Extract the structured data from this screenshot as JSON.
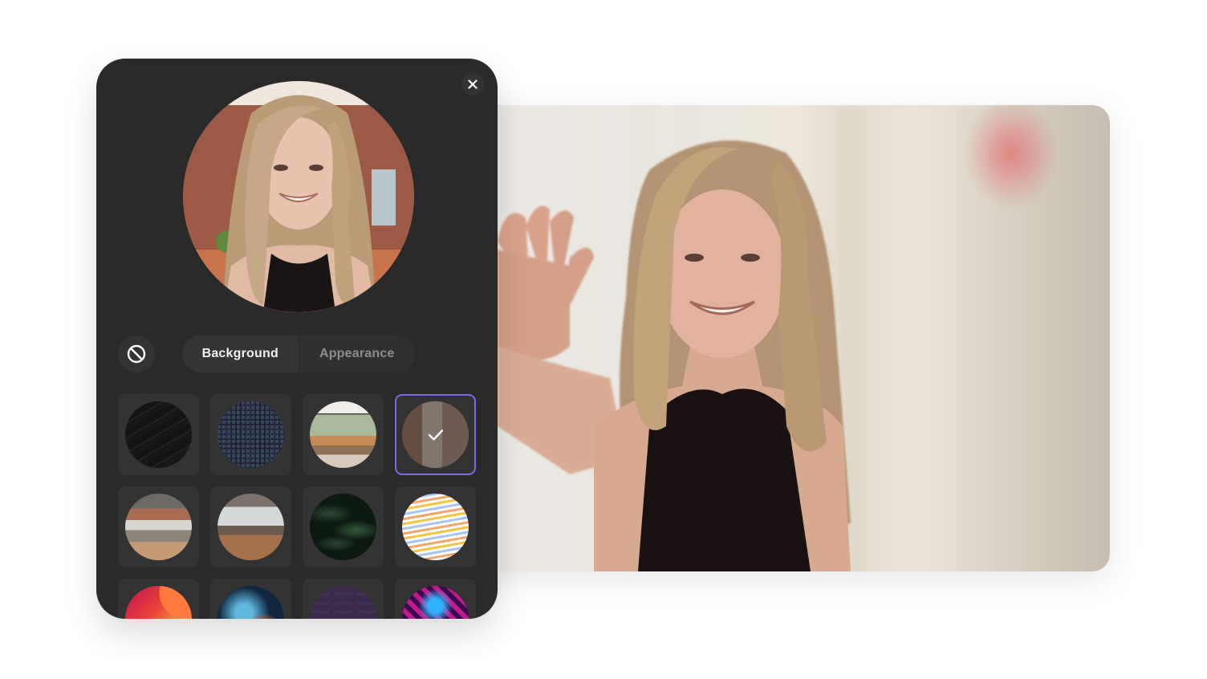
{
  "panel": {
    "close_icon": "close-icon",
    "preview_alt": "Camera preview with virtual background",
    "no_effect_icon": "prohibited-icon",
    "tabs": [
      {
        "label": "Background",
        "active": true
      },
      {
        "label": "Appearance",
        "active": false
      }
    ],
    "backgrounds": [
      {
        "name": "black-sand",
        "selected": false
      },
      {
        "name": "dark-texture",
        "selected": false
      },
      {
        "name": "living-room",
        "selected": false
      },
      {
        "name": "brick-loft",
        "selected": true
      },
      {
        "name": "office-1",
        "selected": false
      },
      {
        "name": "office-2",
        "selected": false
      },
      {
        "name": "leaves",
        "selected": false
      },
      {
        "name": "waves",
        "selected": false
      },
      {
        "name": "gradient-flow",
        "selected": false
      },
      {
        "name": "galaxy",
        "selected": false
      },
      {
        "name": "purple-brand",
        "selected": false,
        "watermark": "sendspark"
      },
      {
        "name": "neon-cubes",
        "selected": false
      }
    ],
    "selected_icon": "checkmark-icon"
  },
  "video": {
    "description": "Live camera feed with blurred background"
  },
  "colors": {
    "panel_bg": "#2a2a2a",
    "selected_border": "#7b68ee",
    "active_tab_text": "#f2f2f2",
    "inactive_tab_text": "#8d8d8d"
  }
}
